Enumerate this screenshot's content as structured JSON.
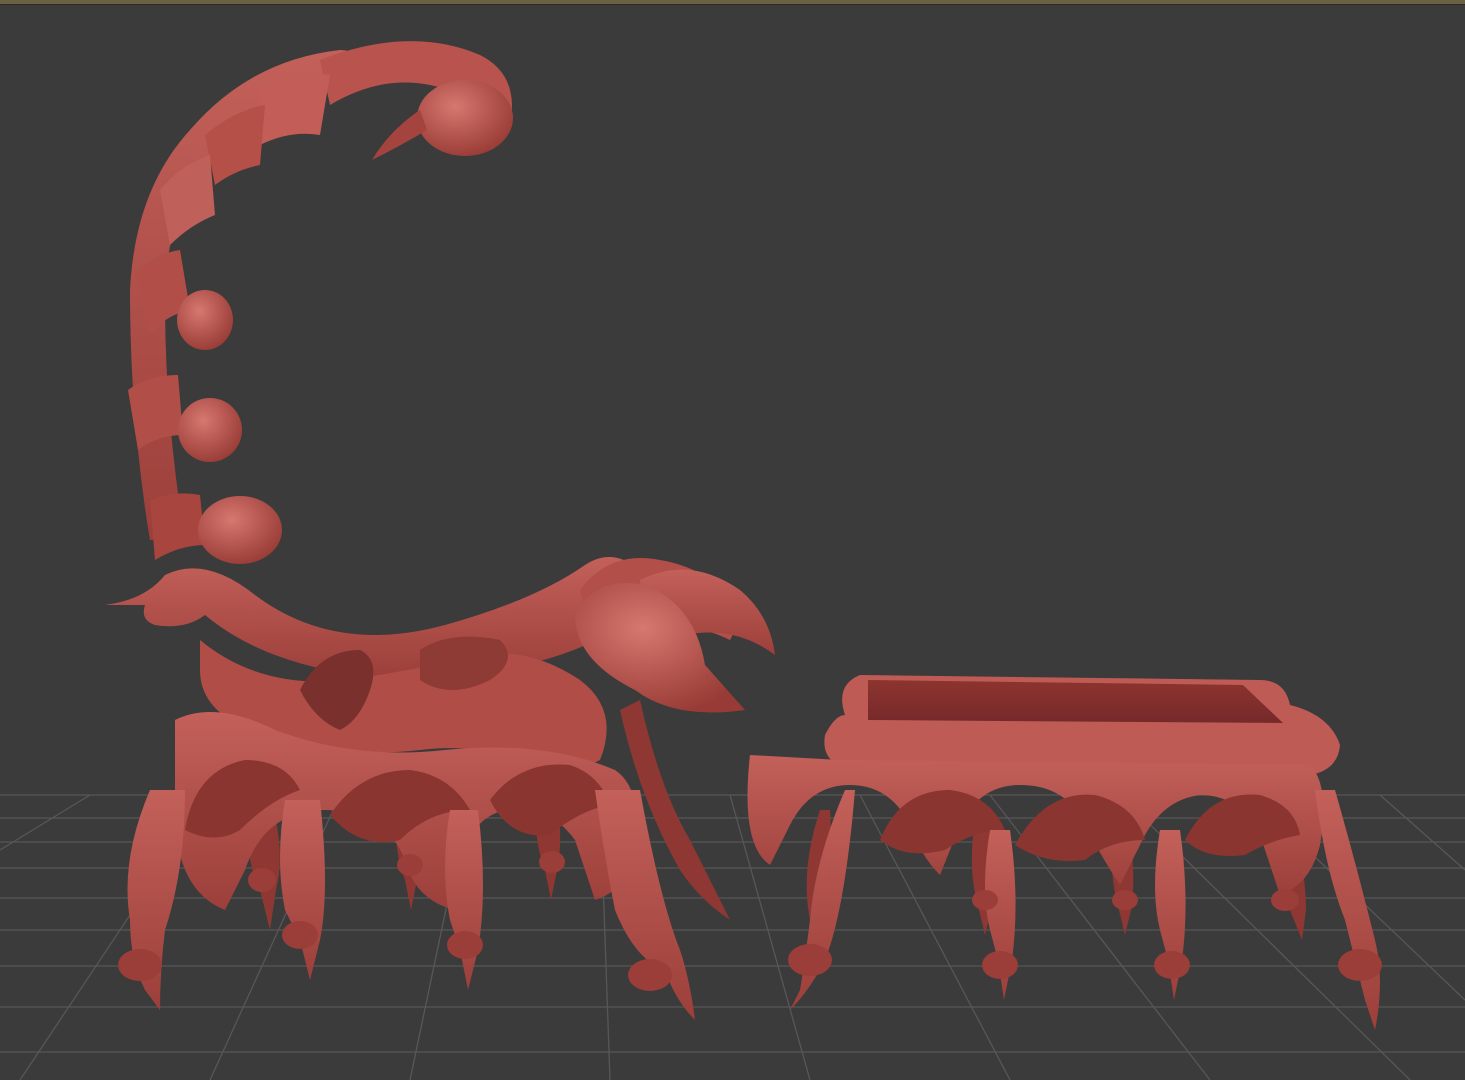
{
  "viewport": {
    "background_color": "#3b3b3b",
    "grid_color": "#555555",
    "top_border_color": "#6b6244"
  },
  "scene": {
    "objects": [
      {
        "name": "scorpion-chair",
        "color": "#b04e48"
      },
      {
        "name": "scorpion-ottoman",
        "color": "#b04e48"
      }
    ],
    "material_color": "#b04e48",
    "shadow_color": "#7a302c",
    "highlight_color": "#d77a70"
  }
}
